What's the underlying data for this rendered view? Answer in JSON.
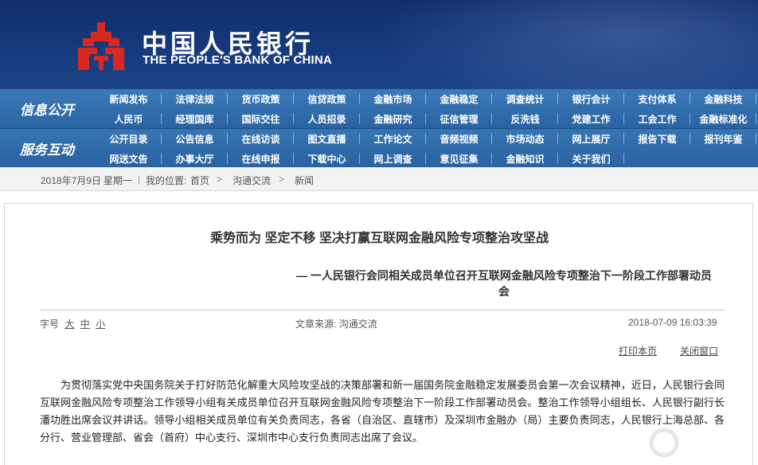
{
  "header": {
    "name_cn": "中国人民银行",
    "name_en": "THE PEOPLE'S BANK OF CHINA",
    "emblem_icon": "pboc-emblem-icon",
    "brand_red": "#d9281f",
    "brand_blue": "#16397d"
  },
  "nav": {
    "categories": [
      "信息公开",
      "服务互动"
    ],
    "rows": [
      [
        "新闻发布",
        "法律法规",
        "货币政策",
        "信贷政策",
        "金融市场",
        "金融稳定",
        "调查统计",
        "银行会计",
        "支付体系",
        "金融科技"
      ],
      [
        "人民币",
        "经理国库",
        "国际交往",
        "人员招录",
        "金融研究",
        "征信管理",
        "反洗钱",
        "党建工作",
        "工会工作",
        "金融标准化"
      ],
      [
        "公开目录",
        "公告信息",
        "在线访谈",
        "图文直播",
        "工作论文",
        "音频视频",
        "市场动态",
        "网上展厅",
        "报告下载",
        "报刊年鉴"
      ],
      [
        "网送文告",
        "办事大厅",
        "在线申报",
        "下载中心",
        "网上调查",
        "意见征集",
        "金融知识",
        "关于我们"
      ]
    ]
  },
  "breadcrumb": {
    "date": "2018年7月9日",
    "weekday": "星期一",
    "sep": "|",
    "location_label": "我的位置:",
    "home": "首页",
    "channel": "沟通交流",
    "section": "新闻",
    "arrow": ">"
  },
  "article": {
    "title": "乘势而为 坚定不移 坚决打赢互联网金融风险专项整治攻坚战",
    "subtitle": "— 一人民银行会同相关成员单位召开互联网金融风险专项整治下一阶段工作部署动员会",
    "font_size_label": "字号",
    "font_sizes": [
      "大",
      "中",
      "小"
    ],
    "source_label": "文章来源:",
    "source": "沟通交流",
    "datetime": "2018-07-09 16:03:39",
    "print_label": "打印本页",
    "close_label": "关闭窗口",
    "body": "为贯彻落实党中央国务院关于打好防范化解重大风险攻坚战的决策部署和新一届国务院金融稳定发展委员会第一次会议精神，近日，人民银行会同互联网金融风险专项整治工作领导小组有关成员单位召开互联网金融风险专项整治下一阶段工作部署动员会。整治工作领导小组组长、人民银行副行长潘功胜出席会议并讲话。领导小组相关成员单位有关负责同志，各省（自治区、直辖市）及深圳市金融办（局）主要负责同志，人民银行上海总部、各分行、营业管理部、省会（首府）中心支行、深圳市中心支行负责同志出席了会议。"
  }
}
